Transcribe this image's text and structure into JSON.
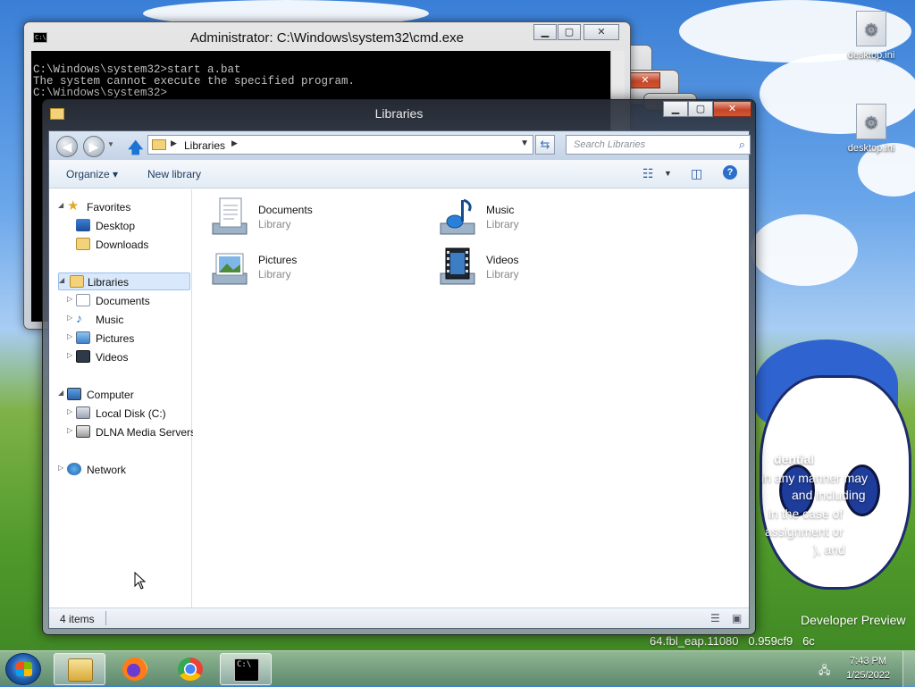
{
  "desktop": {
    "icons": [
      {
        "label": "desktop.ini"
      },
      {
        "label": "desktop.ini"
      }
    ],
    "wallpaper_text": {
      "line1": "dential",
      "line2": "in any manner may",
      "line3": "and including",
      "line4": "in the case of",
      "line5": "assignment or",
      "line6": "), and",
      "line7": "Developer Preview",
      "line8": "64.fbl_eap.11080   0.959cf9   6c"
    }
  },
  "cmd": {
    "title": "Administrator: C:\\Windows\\system32\\cmd.exe",
    "icon_text": "C:\\",
    "lines": [
      "C:\\Windows\\system32>start a.bat",
      "The system cannot execute the specified program.",
      "",
      "C:\\Windows\\system32>"
    ]
  },
  "explorer": {
    "title": "Libraries",
    "address": "Libraries",
    "search_placeholder": "Search Libraries",
    "toolbar": {
      "organize": "Organize ▾",
      "new_library": "New library"
    },
    "nav": {
      "favorites": "Favorites",
      "desktop": "Desktop",
      "downloads": "Downloads",
      "libraries": "Libraries",
      "documents": "Documents",
      "music": "Music",
      "pictures": "Pictures",
      "videos": "Videos",
      "computer": "Computer",
      "local_disk": "Local Disk (C:)",
      "dlna": "DLNA Media Servers",
      "network": "Network"
    },
    "libraries": [
      {
        "name": "Documents",
        "type": "Library"
      },
      {
        "name": "Music",
        "type": "Library"
      },
      {
        "name": "Pictures",
        "type": "Library"
      },
      {
        "name": "Videos",
        "type": "Library"
      }
    ],
    "status": "4 items"
  },
  "taskbar": {
    "time": "7:43 PM",
    "date": "1/25/2022",
    "cmd_icon_text": "C:\\"
  },
  "colors": {
    "accent": "#1d74d2",
    "close_button": "#c6452a",
    "selection": "#d9e8fb"
  }
}
